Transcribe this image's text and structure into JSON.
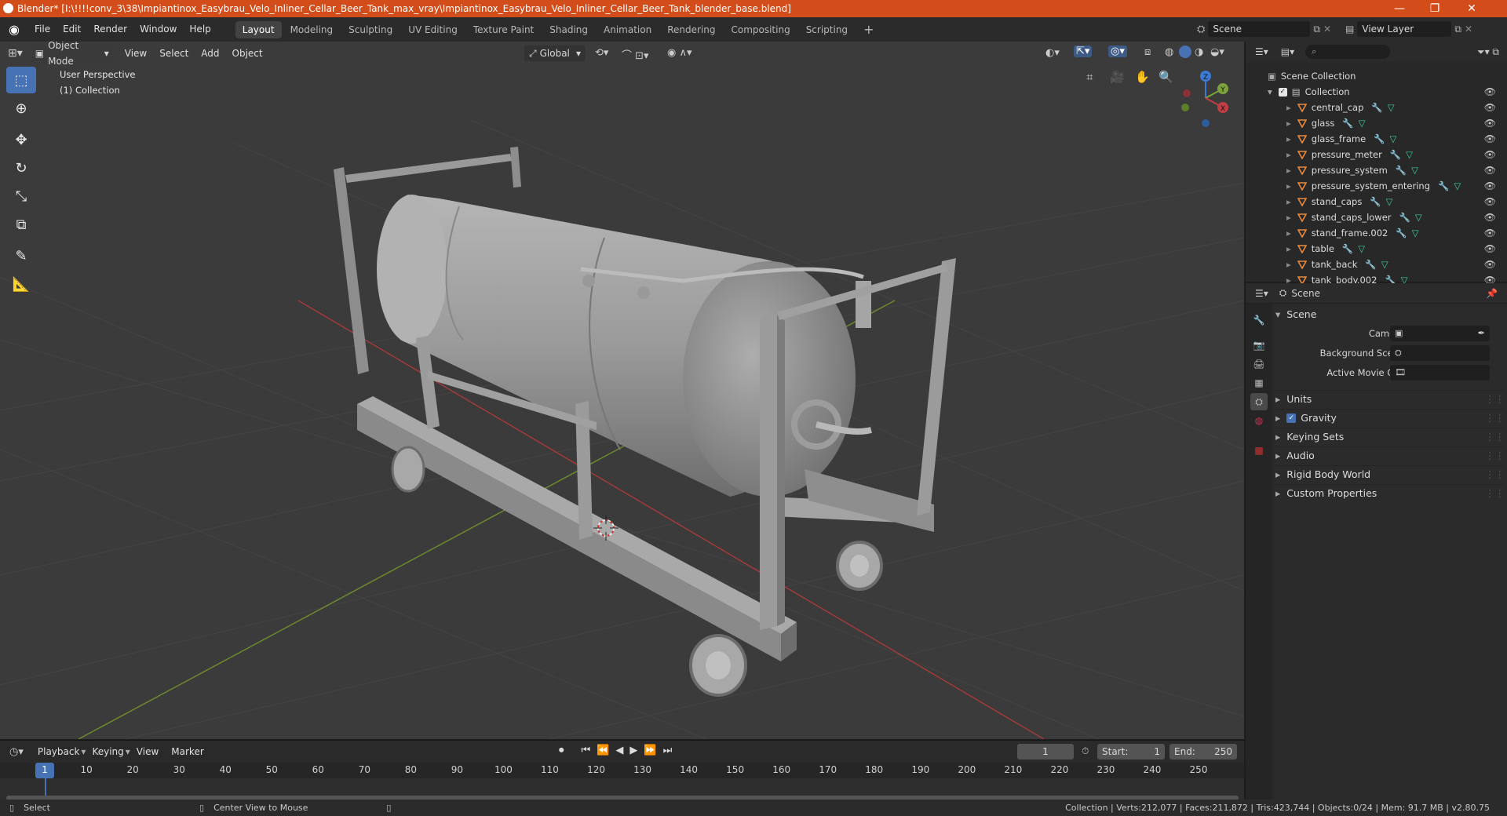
{
  "window": {
    "title": "Blender* [I:\\!!!!conv_3\\38\\Impiantinox_Easybrau_Velo_Inliner_Cellar_Beer_Tank_max_vray\\Impiantinox_Easybrau_Velo_Inliner_Cellar_Beer_Tank_blender_base.blend]",
    "minimize": "—",
    "maximize": "❐",
    "close": "✕"
  },
  "menu": [
    "File",
    "Edit",
    "Render",
    "Window",
    "Help"
  ],
  "workspaces": [
    "Layout",
    "Modeling",
    "Sculpting",
    "UV Editing",
    "Texture Paint",
    "Shading",
    "Animation",
    "Rendering",
    "Compositing",
    "Scripting"
  ],
  "active_workspace": "Layout",
  "scene_selector": "Scene",
  "view_layer": "View Layer",
  "viewport": {
    "mode": "Object Mode",
    "menus": [
      "View",
      "Select",
      "Add",
      "Object"
    ],
    "transform": "Global",
    "overlay_line1": "User Perspective",
    "overlay_line2": "(1) Collection"
  },
  "gizmo": {
    "x": "X",
    "y": "Y",
    "z": "Z"
  },
  "outliner": {
    "root": "Scene Collection",
    "collection": "Collection",
    "objects": [
      "central_cap",
      "glass",
      "glass_frame",
      "pressure_meter",
      "pressure_system",
      "pressure_system_entering",
      "stand_caps",
      "stand_caps_lower",
      "stand_frame.002",
      "table",
      "tank_back",
      "tank_body.002"
    ]
  },
  "properties": {
    "header": "Scene",
    "section": "Scene",
    "fields": [
      {
        "label": "Camera"
      },
      {
        "label": "Background Scene"
      },
      {
        "label": "Active Movie Clip"
      }
    ],
    "panels": [
      "Units",
      "Gravity",
      "Keying Sets",
      "Audio",
      "Rigid Body World",
      "Custom Properties"
    ],
    "gravity_checked": true
  },
  "timeline": {
    "menus": [
      "Playback",
      "Keying",
      "View",
      "Marker"
    ],
    "current_frame": "1",
    "start_label": "Start:",
    "start": "1",
    "end_label": "End:",
    "end": "250",
    "ticks": [
      "1",
      "10",
      "20",
      "30",
      "40",
      "50",
      "60",
      "70",
      "80",
      "90",
      "100",
      "110",
      "120",
      "130",
      "140",
      "150",
      "160",
      "170",
      "180",
      "190",
      "200",
      "210",
      "220",
      "230",
      "240",
      "250"
    ]
  },
  "status": {
    "select": "Select",
    "center_view": "Center View to Mouse",
    "stats": "Collection | Verts:212,077 | Faces:211,872 | Tris:423,744 | Objects:0/24 | Mem: 91.7 MB | v2.80.75"
  },
  "colors": {
    "titlebar": "#d34d1a",
    "active_tool": "#4772b3",
    "x_axis": "#c33d45",
    "y_axis": "#7ba33b",
    "z_axis": "#3b7bd3",
    "object_icon": "#e8893c"
  }
}
